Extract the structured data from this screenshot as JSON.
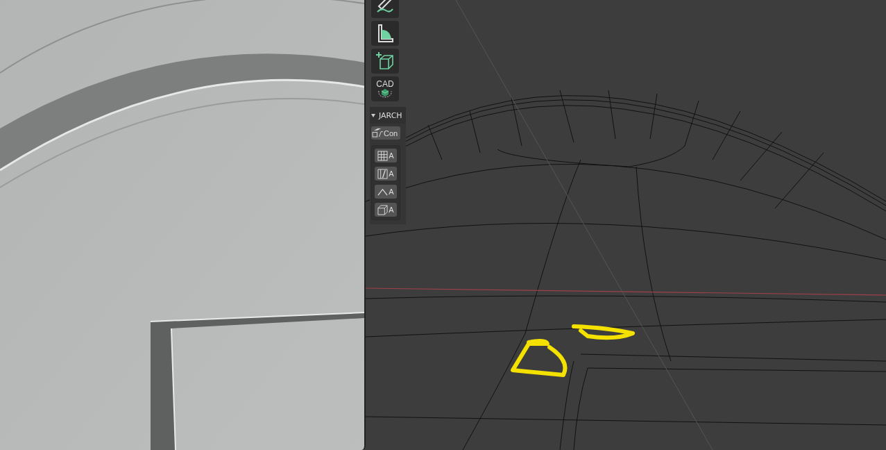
{
  "toolbar": {
    "tools": [
      {
        "kind": "annotate"
      },
      {
        "kind": "measure"
      },
      {
        "kind": "add-cube"
      },
      {
        "kind": "cad",
        "label": "CAD"
      }
    ]
  },
  "panel": {
    "title": "JARCH",
    "expanded": true,
    "button": "Con",
    "tools": [
      {
        "kind": "grid",
        "label": "A"
      },
      {
        "kind": "door",
        "label": "A"
      },
      {
        "kind": "roof",
        "label": "A"
      },
      {
        "kind": "box",
        "label": "A"
      }
    ]
  }
}
